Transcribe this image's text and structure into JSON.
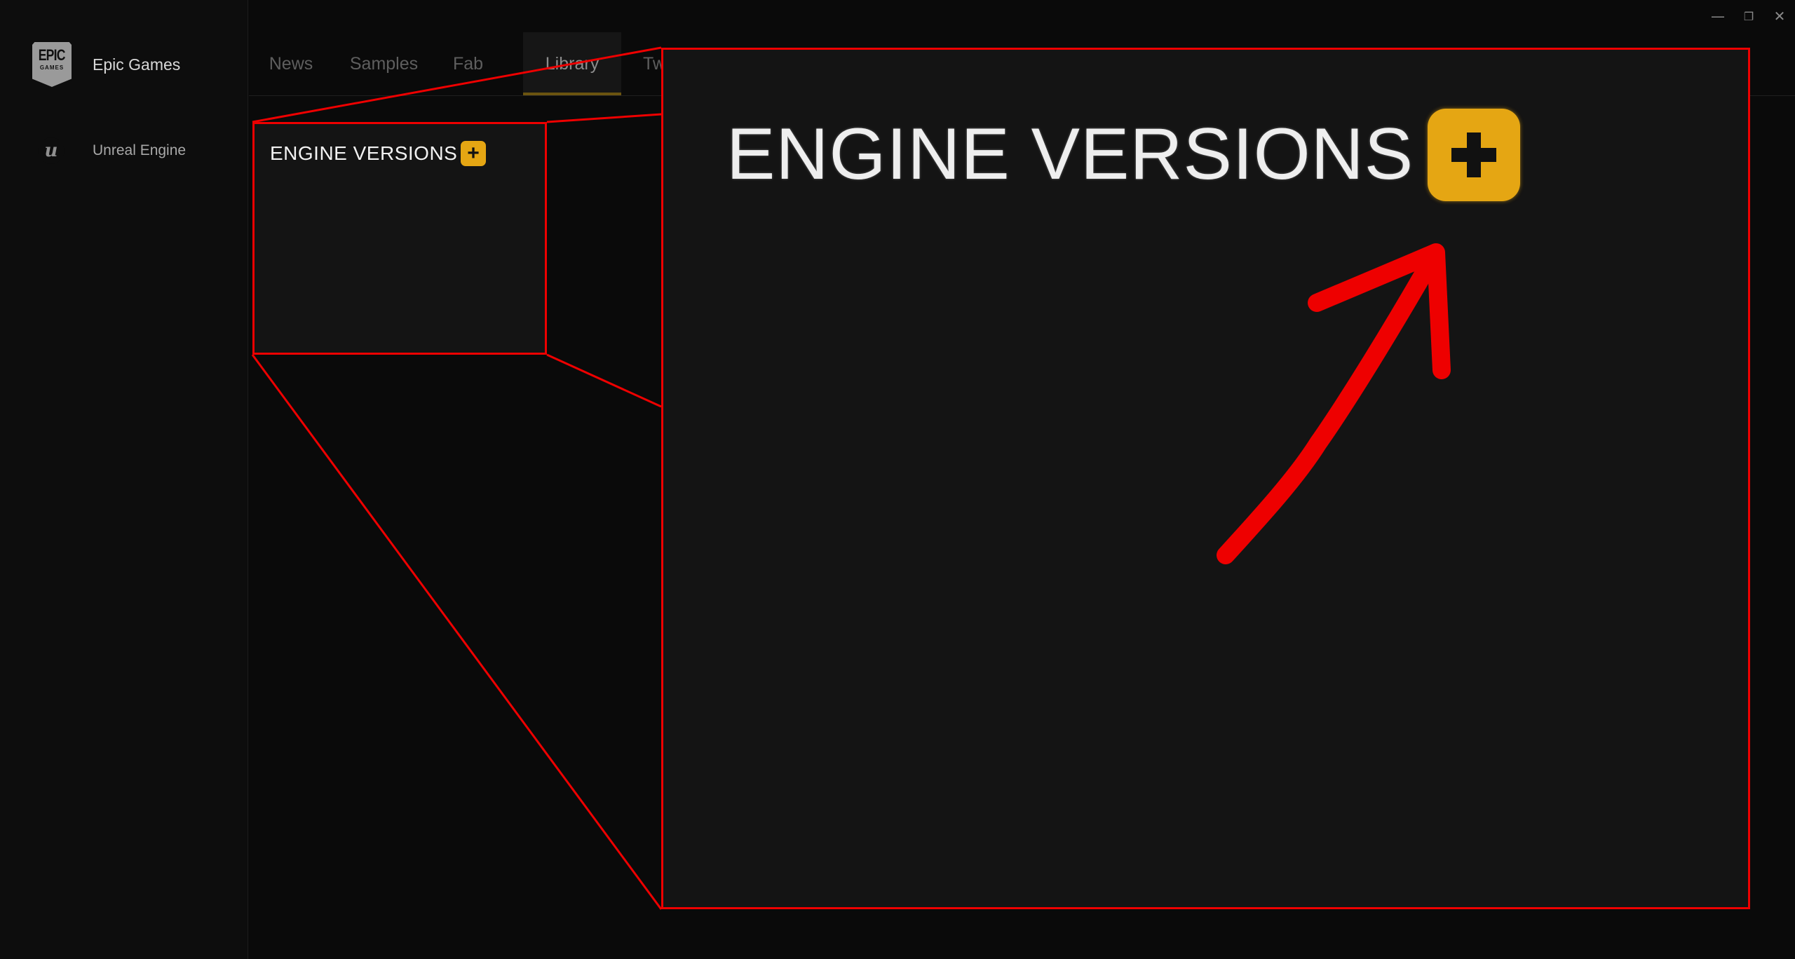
{
  "window_controls": {
    "minimize": "—",
    "restore": "❐",
    "close": "✕"
  },
  "sidebar": {
    "brand": {
      "logo_line1": "EPIC",
      "logo_line2": "GAMES",
      "label": "Epic Games"
    },
    "items": [
      {
        "label": "Unreal Engine",
        "icon": "unreal-engine-icon",
        "icon_glyph": "u"
      }
    ]
  },
  "tabs": [
    {
      "label": "News"
    },
    {
      "label": "Samples"
    },
    {
      "label": "Fab"
    },
    {
      "label": "Library",
      "active": true
    },
    {
      "label": "Tw"
    }
  ],
  "library": {
    "section_title": "ENGINE VERSIONS",
    "add_glyph": "+"
  },
  "zoom": {
    "section_title": "ENGINE VERSIONS"
  },
  "colors": {
    "accent": "#e5a613",
    "annotation": "#ee0000",
    "background": "#0a0a0a"
  }
}
